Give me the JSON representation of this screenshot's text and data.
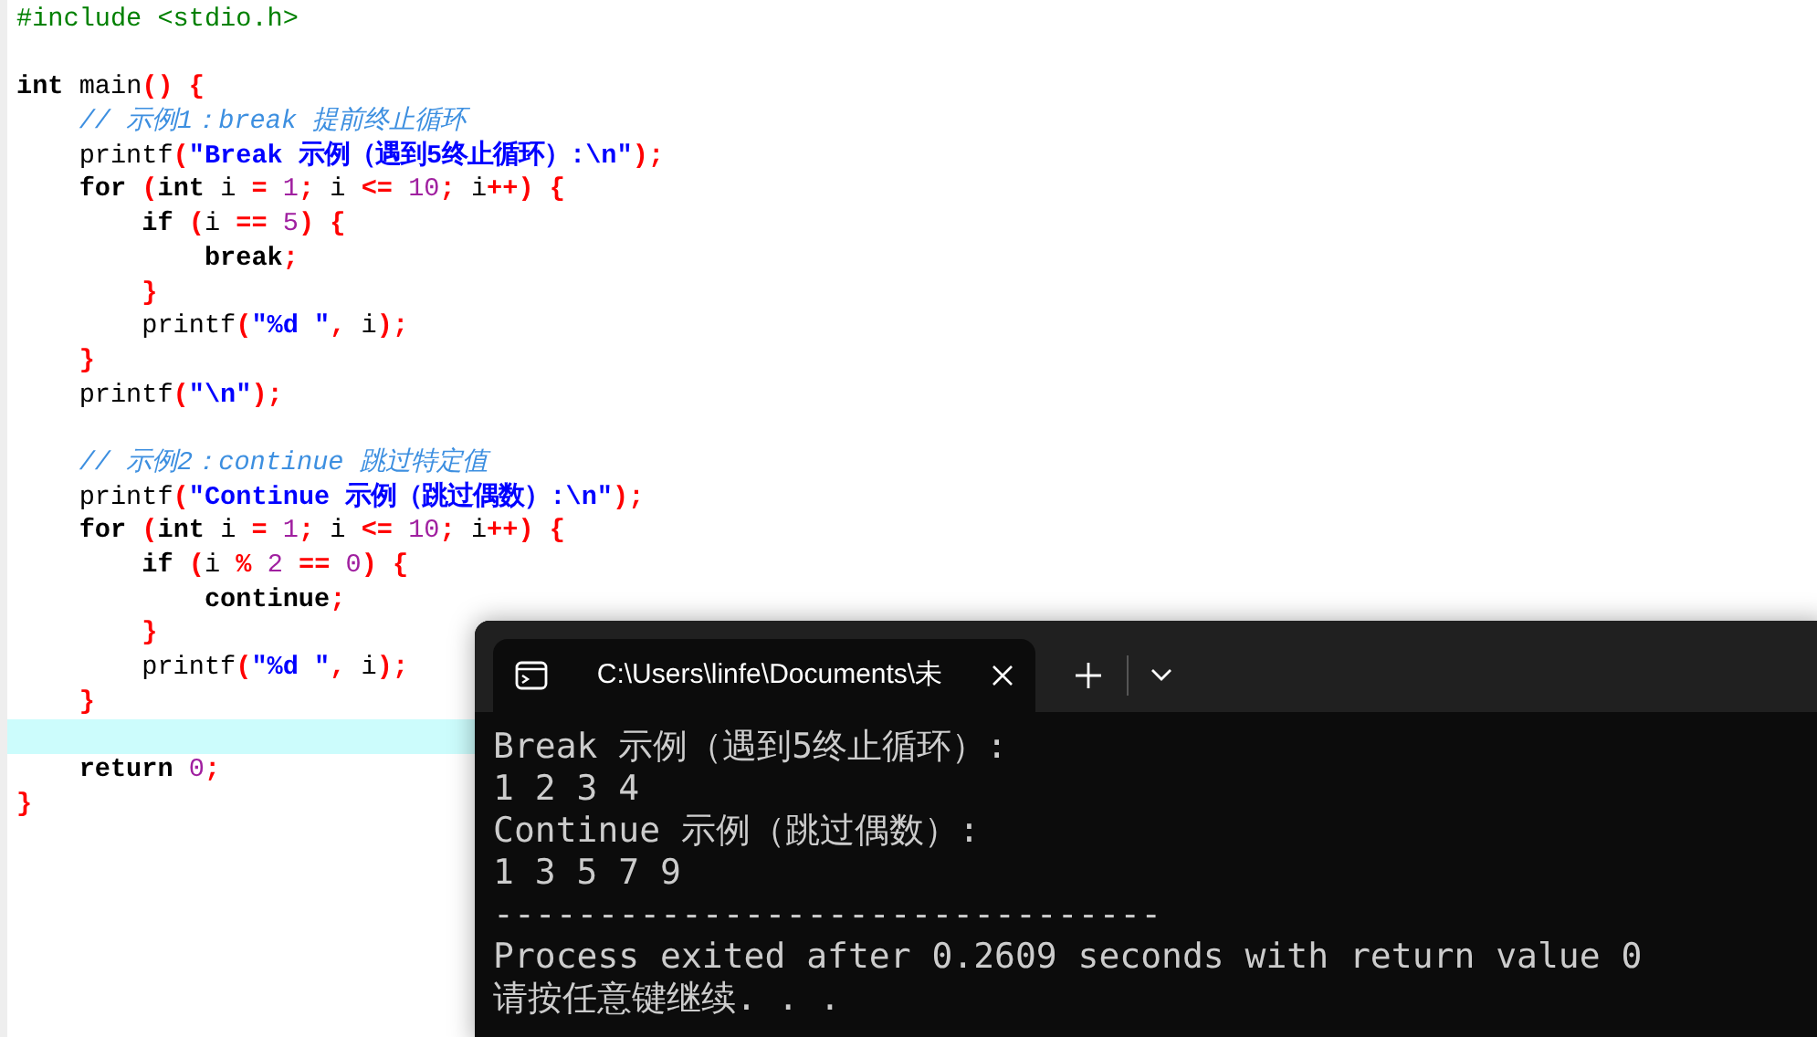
{
  "editor": {
    "lines": [
      {
        "current": false,
        "tokens": [
          {
            "text": "#include <stdio.h>",
            "kind": "preprocessor"
          }
        ]
      },
      {
        "current": false
      },
      {
        "current": false,
        "tokens": [
          {
            "text": "int",
            "kind": "keyword"
          },
          {
            "text": " main",
            "kind": "plain"
          },
          {
            "text": "() {",
            "kind": "symbol"
          }
        ],
        "children": [
          {
            "current": false,
            "tokens": [
              {
                "text": "// 示例1：break 提前终止循环",
                "kind": "comment"
              }
            ]
          },
          {
            "current": false,
            "tokens": [
              {
                "text": "printf",
                "kind": "plain"
              },
              {
                "text": "(",
                "kind": "symbol"
              },
              {
                "text": "\"Break 示例（遇到5终止循环）:\\n\"",
                "kind": "string"
              },
              {
                "text": ");",
                "kind": "symbol"
              }
            ]
          },
          {
            "current": false,
            "tokens": [
              {
                "text": "for",
                "kind": "keyword"
              },
              {
                "text": " (",
                "kind": "symbol"
              },
              {
                "text": "int",
                "kind": "keyword"
              },
              {
                "text": " i ",
                "kind": "plain"
              },
              {
                "text": "=",
                "kind": "symbol"
              },
              {
                "text": " 1",
                "kind": "number"
              },
              {
                "text": ";",
                "kind": "symbol"
              },
              {
                "text": " i ",
                "kind": "plain"
              },
              {
                "text": "<=",
                "kind": "symbol"
              },
              {
                "text": " 10",
                "kind": "number"
              },
              {
                "text": ";",
                "kind": "symbol"
              },
              {
                "text": " i",
                "kind": "plain"
              },
              {
                "text": "++) {",
                "kind": "symbol"
              }
            ],
            "children": [
              {
                "current": false,
                "tokens": [
                  {
                    "text": "if",
                    "kind": "keyword"
                  },
                  {
                    "text": " (",
                    "kind": "symbol"
                  },
                  {
                    "text": "i ",
                    "kind": "plain"
                  },
                  {
                    "text": "==",
                    "kind": "symbol"
                  },
                  {
                    "text": " 5",
                    "kind": "number"
                  },
                  {
                    "text": ") {",
                    "kind": "symbol"
                  }
                ],
                "children": [
                  {
                    "current": false,
                    "tokens": [
                      {
                        "text": "break",
                        "kind": "keyword"
                      },
                      {
                        "text": ";",
                        "kind": "symbol"
                      }
                    ]
                  }
                ]
              },
              {
                "current": false,
                "tokens": [
                  {
                    "text": "}",
                    "kind": "symbol"
                  }
                ]
              },
              {
                "current": false,
                "tokens": [
                  {
                    "text": "printf",
                    "kind": "plain"
                  },
                  {
                    "text": "(",
                    "kind": "symbol"
                  },
                  {
                    "text": "\"%d \"",
                    "kind": "string"
                  },
                  {
                    "text": ",",
                    "kind": "symbol"
                  },
                  {
                    "text": " i",
                    "kind": "plain"
                  },
                  {
                    "text": ");",
                    "kind": "symbol"
                  }
                ]
              }
            ]
          },
          {
            "current": false,
            "tokens": [
              {
                "text": "}",
                "kind": "symbol"
              }
            ]
          },
          {
            "current": false,
            "tokens": [
              {
                "text": "printf",
                "kind": "plain"
              },
              {
                "text": "(",
                "kind": "symbol"
              },
              {
                "text": "\"\\n\"",
                "kind": "string"
              },
              {
                "text": ");",
                "kind": "symbol"
              }
            ]
          },
          {
            "current": false
          },
          {
            "current": false,
            "tokens": [
              {
                "text": "// 示例2：continue 跳过特定值",
                "kind": "comment"
              }
            ]
          },
          {
            "current": false,
            "tokens": [
              {
                "text": "printf",
                "kind": "plain"
              },
              {
                "text": "(",
                "kind": "symbol"
              },
              {
                "text": "\"Continue 示例（跳过偶数）:\\n\"",
                "kind": "string"
              },
              {
                "text": ");",
                "kind": "symbol"
              }
            ]
          },
          {
            "current": false,
            "tokens": [
              {
                "text": "for",
                "kind": "keyword"
              },
              {
                "text": " (",
                "kind": "symbol"
              },
              {
                "text": "int",
                "kind": "keyword"
              },
              {
                "text": " i ",
                "kind": "plain"
              },
              {
                "text": "=",
                "kind": "symbol"
              },
              {
                "text": " 1",
                "kind": "number"
              },
              {
                "text": ";",
                "kind": "symbol"
              },
              {
                "text": " i ",
                "kind": "plain"
              },
              {
                "text": "<=",
                "kind": "symbol"
              },
              {
                "text": " 10",
                "kind": "number"
              },
              {
                "text": ";",
                "kind": "symbol"
              },
              {
                "text": " i",
                "kind": "plain"
              },
              {
                "text": "++) {",
                "kind": "symbol"
              }
            ],
            "children": [
              {
                "current": false,
                "tokens": [
                  {
                    "text": "if",
                    "kind": "keyword"
                  },
                  {
                    "text": " (",
                    "kind": "symbol"
                  },
                  {
                    "text": "i ",
                    "kind": "plain"
                  },
                  {
                    "text": "%",
                    "kind": "symbol"
                  },
                  {
                    "text": " 2 ",
                    "kind": "number"
                  },
                  {
                    "text": "==",
                    "kind": "symbol"
                  },
                  {
                    "text": " 0",
                    "kind": "number"
                  },
                  {
                    "text": ") {",
                    "kind": "symbol"
                  }
                ],
                "children": [
                  {
                    "current": false,
                    "tokens": [
                      {
                        "text": "continue",
                        "kind": "keyword"
                      },
                      {
                        "text": ";",
                        "kind": "symbol"
                      }
                    ]
                  }
                ]
              },
              {
                "current": false,
                "tokens": [
                  {
                    "text": "}",
                    "kind": "symbol"
                  }
                ]
              },
              {
                "current": false,
                "tokens": [
                  {
                    "text": "printf",
                    "kind": "plain"
                  },
                  {
                    "text": "(",
                    "kind": "symbol"
                  },
                  {
                    "text": "\"%d \"",
                    "kind": "string"
                  },
                  {
                    "text": ",",
                    "kind": "symbol"
                  },
                  {
                    "text": " i",
                    "kind": "plain"
                  },
                  {
                    "text": ");",
                    "kind": "symbol"
                  }
                ]
              }
            ]
          },
          {
            "current": false,
            "tokens": [
              {
                "text": "}",
                "kind": "symbol"
              }
            ]
          },
          {
            "current": true
          },
          {
            "current": false,
            "tokens": [
              {
                "text": "return",
                "kind": "keyword"
              },
              {
                "text": " 0",
                "kind": "number"
              },
              {
                "text": ";",
                "kind": "symbol"
              }
            ]
          }
        ]
      },
      {
        "current": false,
        "tokens": [
          {
            "text": "}",
            "kind": "symbol"
          }
        ]
      }
    ]
  },
  "terminal": {
    "tab": {
      "title": "C:\\Users\\linfe\\Documents\\未",
      "selected": true
    },
    "lines": [
      "Break 示例（遇到5终止循环）:",
      "1 2 3 4",
      "Continue 示例（跳过偶数）:",
      "1 3 5 7 9",
      "--------------------------------",
      "Process exited after 0.2609 seconds with return value 0",
      "请按任意键继续. . ."
    ]
  }
}
